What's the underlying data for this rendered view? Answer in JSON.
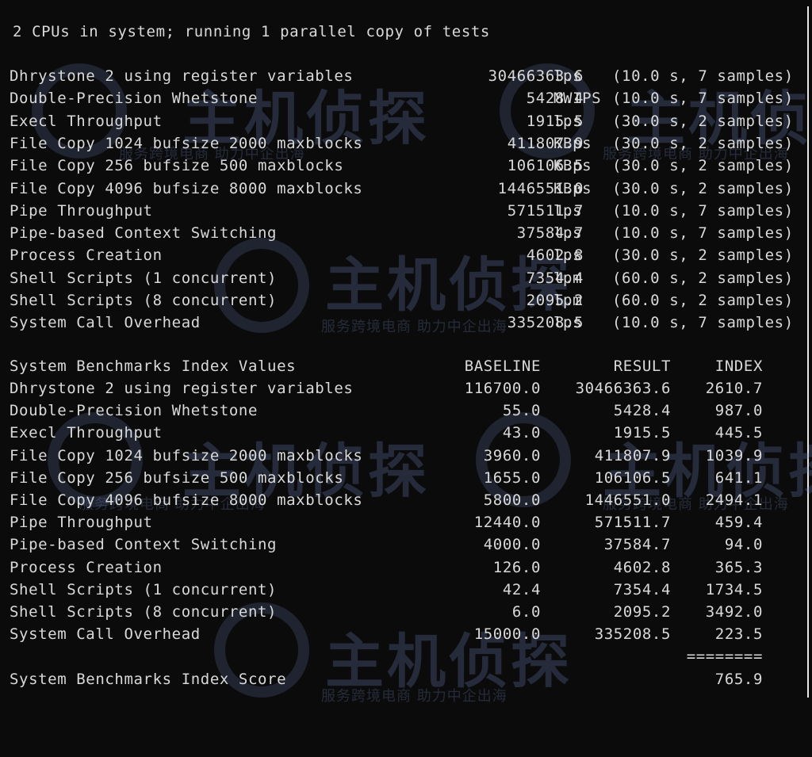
{
  "header": "2 CPUs in system; running 1 parallel copy of tests",
  "results": [
    {
      "name": "Dhrystone 2 using register variables",
      "value": "30466363.6",
      "unit": "lps",
      "samples": "(10.0 s, 7 samples)"
    },
    {
      "name": "Double-Precision Whetstone",
      "value": "5428.4",
      "unit": "MWIPS",
      "samples": "(10.0 s, 7 samples)"
    },
    {
      "name": "Execl Throughput",
      "value": "1915.5",
      "unit": "lps",
      "samples": "(30.0 s, 2 samples)"
    },
    {
      "name": "File Copy 1024 bufsize 2000 maxblocks",
      "value": "411807.9",
      "unit": "KBps",
      "samples": "(30.0 s, 2 samples)"
    },
    {
      "name": "File Copy 256 bufsize 500 maxblocks",
      "value": "106106.5",
      "unit": "KBps",
      "samples": "(30.0 s, 2 samples)"
    },
    {
      "name": "File Copy 4096 bufsize 8000 maxblocks",
      "value": "1446551.0",
      "unit": "KBps",
      "samples": "(30.0 s, 2 samples)"
    },
    {
      "name": "Pipe Throughput",
      "value": "571511.7",
      "unit": "lps",
      "samples": "(10.0 s, 7 samples)"
    },
    {
      "name": "Pipe-based Context Switching",
      "value": "37584.7",
      "unit": "lps",
      "samples": "(10.0 s, 7 samples)"
    },
    {
      "name": "Process Creation",
      "value": "4602.8",
      "unit": "lps",
      "samples": "(30.0 s, 2 samples)"
    },
    {
      "name": "Shell Scripts (1 concurrent)",
      "value": "7354.4",
      "unit": "lpm",
      "samples": "(60.0 s, 2 samples)"
    },
    {
      "name": "Shell Scripts (8 concurrent)",
      "value": "2095.2",
      "unit": "lpm",
      "samples": "(60.0 s, 2 samples)"
    },
    {
      "name": "System Call Overhead",
      "value": "335208.5",
      "unit": "lps",
      "samples": "(10.0 s, 7 samples)"
    }
  ],
  "index": {
    "title": "System Benchmarks Index Values",
    "baseline_header": "BASELINE",
    "result_header": "RESULT",
    "index_header": "INDEX",
    "rows": [
      {
        "name": "Dhrystone 2 using register variables",
        "baseline": "116700.0",
        "result": "30466363.6",
        "index": "2610.7"
      },
      {
        "name": "Double-Precision Whetstone",
        "baseline": "55.0",
        "result": "5428.4",
        "index": "987.0"
      },
      {
        "name": "Execl Throughput",
        "baseline": "43.0",
        "result": "1915.5",
        "index": "445.5"
      },
      {
        "name": "File Copy 1024 bufsize 2000 maxblocks",
        "baseline": "3960.0",
        "result": "411807.9",
        "index": "1039.9"
      },
      {
        "name": "File Copy 256 bufsize 500 maxblocks",
        "baseline": "1655.0",
        "result": "106106.5",
        "index": "641.1"
      },
      {
        "name": "File Copy 4096 bufsize 8000 maxblocks",
        "baseline": "5800.0",
        "result": "1446551.0",
        "index": "2494.1"
      },
      {
        "name": "Pipe Throughput",
        "baseline": "12440.0",
        "result": "571511.7",
        "index": "459.4"
      },
      {
        "name": "Pipe-based Context Switching",
        "baseline": "4000.0",
        "result": "37584.7",
        "index": "94.0"
      },
      {
        "name": "Process Creation",
        "baseline": "126.0",
        "result": "4602.8",
        "index": "365.3"
      },
      {
        "name": "Shell Scripts (1 concurrent)",
        "baseline": "42.4",
        "result": "7354.4",
        "index": "1734.5"
      },
      {
        "name": "Shell Scripts (8 concurrent)",
        "baseline": "6.0",
        "result": "2095.2",
        "index": "3492.0"
      },
      {
        "name": "System Call Overhead",
        "baseline": "15000.0",
        "result": "335208.5",
        "index": "223.5"
      }
    ],
    "separator": "========",
    "score_label": "System Benchmarks Index Score",
    "score_value": "765.9"
  },
  "watermark": {
    "brand": "主机侦探",
    "tagline": "服务跨境电商 助力中企出海"
  },
  "colors": {
    "background": "#0b0b0b",
    "text": "#d9d9d9",
    "watermark": "#6a7fb4"
  }
}
